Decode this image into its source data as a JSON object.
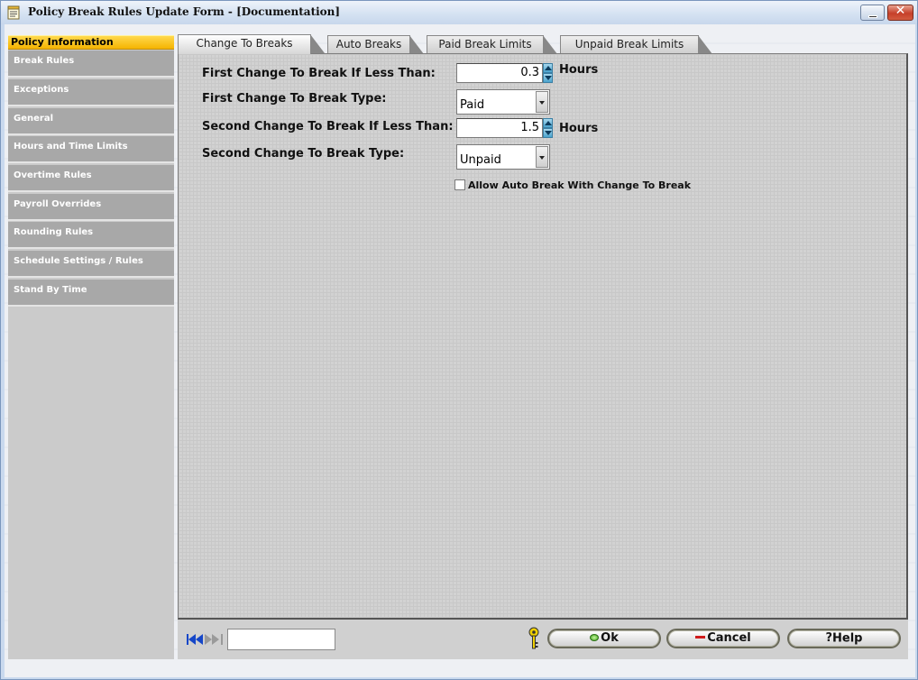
{
  "window": {
    "title": "Policy Break Rules Update Form - [Documentation]",
    "icons": {
      "app": "form-icon",
      "minimize": "minimize-icon",
      "close": "close-icon"
    },
    "close_glyph": "✕"
  },
  "sidebar": {
    "header": "Policy Information",
    "items": [
      {
        "label": "Break Rules"
      },
      {
        "label": "Exceptions"
      },
      {
        "label": "General"
      },
      {
        "label": "Hours and Time Limits"
      },
      {
        "label": "Overtime Rules"
      },
      {
        "label": "Payroll Overrides"
      },
      {
        "label": "Rounding Rules"
      },
      {
        "label": "Schedule Settings / Rules"
      },
      {
        "label": "Stand By Time"
      }
    ]
  },
  "tabs": [
    {
      "label": "Change To Breaks",
      "active": true
    },
    {
      "label": "Auto Breaks",
      "active": false
    },
    {
      "label": "Paid Break Limits",
      "active": false
    },
    {
      "label": "Unpaid Break Limits",
      "active": false
    }
  ],
  "form": {
    "first_if_less_label": "First Change To Break If Less Than:",
    "first_if_less_value": "0.3",
    "first_unit": "Hours",
    "first_type_label": "First Change To Break Type:",
    "first_type_value": "Paid",
    "second_if_less_label": "Second Change To Break If Less Than:",
    "second_if_less_value": "1.5",
    "second_unit": "Hours",
    "second_type_label": "Second Change To Break Type:",
    "second_type_value": "Unpaid",
    "auto_break_label": "Allow Auto Break With Change To Break",
    "auto_break_checked": false
  },
  "bottom": {
    "record_input_value": "",
    "ok_label": "Ok",
    "cancel_label": "Cancel",
    "help_label": "Help",
    "help_glyph": "?"
  },
  "colors": {
    "sidebar_header": "#f5b400",
    "sidebar_item": "#a8a8a8",
    "spinner": "#4aa3cd",
    "ok_icon": "#38a418",
    "cancel_icon": "#d01c1c"
  }
}
